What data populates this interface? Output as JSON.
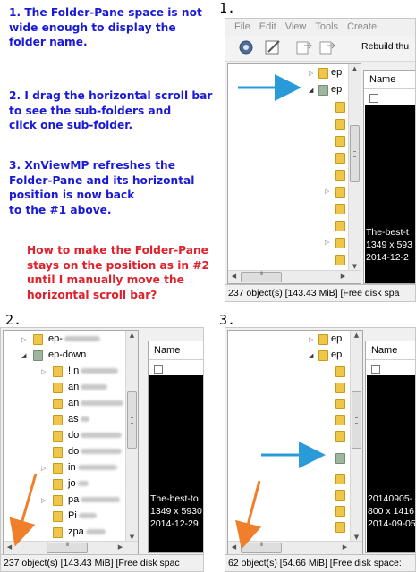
{
  "notes": {
    "n1": "1. The Folder-Pane space is not\nwide enough to display the\nfolder name.",
    "n2": "2. I drag the horizontal scroll bar\nto see the sub-folders and\nclick one sub-folder.",
    "n3": "3. XnViewMP refreshes the\nFolder-Pane and its horizontal\nposition is now back\nto the #1 above.",
    "question": "How to make the Folder-Pane\nstays on the position as in #2\nuntil I manually move the\nhorizontal scroll bar?"
  },
  "labels": {
    "p1": "1.",
    "p2": "2.",
    "p3": "3."
  },
  "panel1": {
    "menu": [
      "File",
      "Edit",
      "View",
      "Tools",
      "Create"
    ],
    "toolbar_text": "Rebuild thu",
    "toolbar_icons": [
      "gear-icon",
      "edit-icon",
      "copy-icon",
      "move-icon"
    ],
    "folders": [
      "ep",
      "ep"
    ],
    "name_header": "Name",
    "caption": [
      "The-best-t",
      "1349 x 593",
      "2014-12-2"
    ],
    "status": "237 object(s) [143.43 MiB] [Free disk spa"
  },
  "panel2": {
    "folders": [
      "ep-",
      "ep-down",
      "! n",
      "an",
      "an",
      "as",
      "do",
      "do",
      "in",
      "jo",
      "pa",
      "Pi",
      "zpa"
    ],
    "name_header": "Name",
    "caption": [
      "The-best-to",
      "1349 x 5930",
      "2014-12-29"
    ],
    "status": "237 object(s) [143.43 MiB] [Free disk spac"
  },
  "panel3": {
    "folders": [
      "ep",
      "ep"
    ],
    "name_header": "Name",
    "caption": [
      "20140905-",
      "800 x 1416",
      "2014-09-05"
    ],
    "status": "62 object(s) [54.66 MiB] [Free disk space:"
  },
  "colors": {
    "note_blue": "#1a1ad6",
    "question_red": "#e0202a",
    "arrow_blue": "#2a9ad8",
    "arrow_orange": "#f07f2c",
    "folder_yellow": "#efc64a"
  }
}
